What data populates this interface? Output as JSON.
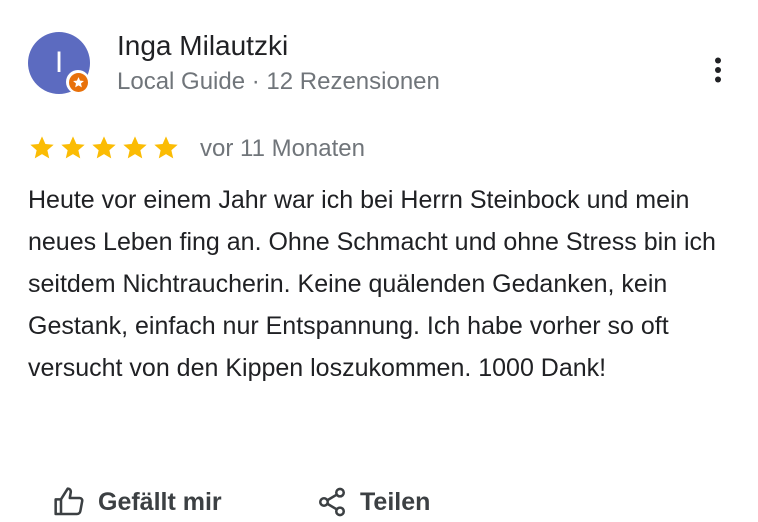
{
  "reviewer": {
    "avatar_initial": "I",
    "name": "Inga Milautzki",
    "meta": "Local Guide · 12 Rezensionen",
    "badge_icon": "local-guide-star-badge"
  },
  "rating": {
    "stars": 5,
    "max_stars": 5,
    "star_color": "#fbbc04",
    "time": "vor 11 Monaten"
  },
  "review": {
    "text": "Heute vor einem Jahr war ich bei Herrn Steinbock und mein neues Leben fing an. Ohne Schmacht und ohne Stress bin ich seitdem Nichtraucherin. Keine quälenden Gedanken, kein Gestank, einfach nur Entspannung. Ich habe vorher so oft versucht von den Kippen loszukommen. 1000 Dank!"
  },
  "actions": {
    "like_label": "Gefällt mir",
    "share_label": "Teilen"
  },
  "colors": {
    "avatar_bg": "#5c6bc0",
    "badge": "#e8710a",
    "secondary_text": "#70757a"
  }
}
